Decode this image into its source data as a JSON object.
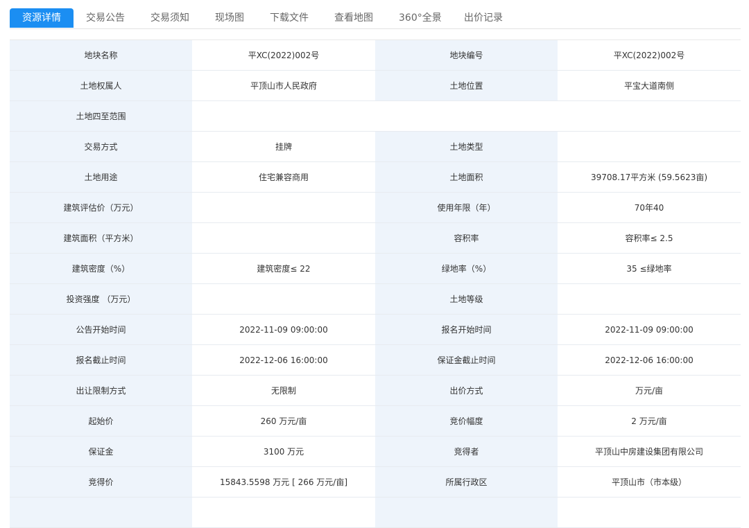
{
  "tabs": [
    {
      "label": "资源详情",
      "active": true
    },
    {
      "label": "交易公告"
    },
    {
      "label": "交易须知"
    },
    {
      "label": "现场图"
    },
    {
      "label": "下载文件"
    },
    {
      "label": "查看地图"
    },
    {
      "label": "360°全景"
    },
    {
      "label": "出价记录"
    }
  ],
  "rows": [
    {
      "l1": "地块名称",
      "v1": "平XC(2022)002号",
      "l2": "地块编号",
      "v2": "平XC(2022)002号"
    },
    {
      "l1": "土地权属人",
      "v1": "平顶山市人民政府",
      "l2": "土地位置",
      "v2": "平宝大道南侧"
    },
    {
      "l1": "土地四至范围",
      "v1": ""
    },
    {
      "l1": "交易方式",
      "v1": "挂牌",
      "l2": "土地类型",
      "v2": ""
    },
    {
      "l1": "土地用途",
      "v1": "住宅兼容商用",
      "l2": "土地面积",
      "v2": "39708.17平方米 (59.5623亩)"
    },
    {
      "l1": "建筑评估价（万元）",
      "v1": "",
      "l2": "使用年限（年）",
      "v2": "70年40"
    },
    {
      "l1": "建筑面积（平方米）",
      "v1": "",
      "l2": "容积率",
      "v2": "容积率≤ 2.5"
    },
    {
      "l1": "建筑密度（%）",
      "v1": "建筑密度≤ 22",
      "l2": "绿地率（%）",
      "v2": "35 ≤绿地率"
    },
    {
      "l1": "投资强度 （万元）",
      "v1": "",
      "l2": "土地等级",
      "v2": ""
    },
    {
      "l1": "公告开始时间",
      "v1": "2022-11-09 09:00:00",
      "l2": "报名开始时间",
      "v2": "2022-11-09 09:00:00"
    },
    {
      "l1": "报名截止时间",
      "v1": "2022-12-06 16:00:00",
      "l2": "保证金截止时间",
      "v2": "2022-12-06 16:00:00"
    },
    {
      "l1": "出让限制方式",
      "v1": "无限制",
      "l2": "出价方式",
      "v2": "万元/亩"
    },
    {
      "l1": "起始价",
      "v1": "260 万元/亩",
      "l2": "竞价幅度",
      "v2": "2 万元/亩"
    },
    {
      "l1": "保证金",
      "v1": "3100 万元",
      "l2": "竞得者",
      "v2": "平顶山中房建设集团有限公司"
    },
    {
      "l1": "竞得价",
      "v1": "15843.5598 万元 [ 266 万元/亩]",
      "l2": "所属行政区",
      "v2": "平顶山市（市本级）"
    },
    {
      "l1": "",
      "v1": "",
      "l2": "",
      "v2": ""
    }
  ]
}
